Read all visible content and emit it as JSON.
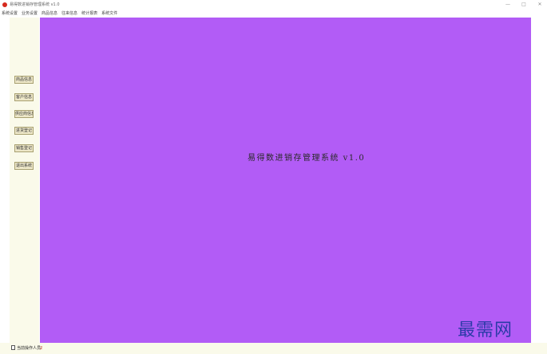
{
  "window": {
    "title": "易得数进销存管理系统 v1.0",
    "minimize": "—",
    "maximize": "□",
    "close": "✕"
  },
  "menu": {
    "items": [
      {
        "label": "系统设置"
      },
      {
        "label": "业务设置"
      },
      {
        "label": "商品信息"
      },
      {
        "label": "往来信息"
      },
      {
        "label": "统计报表"
      },
      {
        "label": "系统文件"
      }
    ]
  },
  "sidebar": {
    "buttons": [
      {
        "label": "商品信息"
      },
      {
        "label": "客户信息"
      },
      {
        "label": "供应商信息"
      },
      {
        "label": "进货登记"
      },
      {
        "label": "销售登记"
      },
      {
        "label": "退出系统"
      }
    ]
  },
  "main": {
    "title": "易得数进销存管理系统 v1.0",
    "background": "#b25cf6"
  },
  "watermark": {
    "text": "最需网"
  },
  "status": {
    "label": "当前操作人员:",
    "count": "2"
  }
}
